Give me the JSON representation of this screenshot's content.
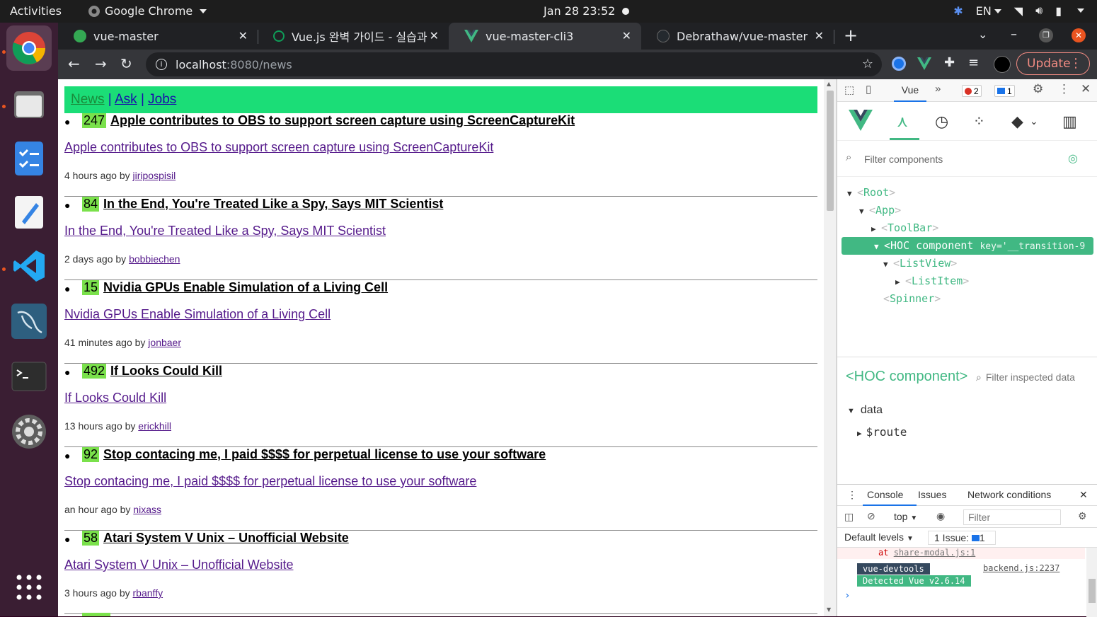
{
  "system": {
    "activities": "Activities",
    "app_name": "Google Chrome",
    "clock": "Jan 28  23:52",
    "lang": "EN"
  },
  "chrome": {
    "tabs": [
      {
        "title": "vue-master",
        "color": "#34a853"
      },
      {
        "title": "Vue.js 완벽 가이드 - 실습과",
        "color": "#0f9d58"
      },
      {
        "title": "vue-master-cli3",
        "color": "#41b883"
      },
      {
        "title": "Debrathaw/vue-master",
        "color": "#24292e"
      }
    ],
    "url_host": "localhost",
    "url_path": ":8080/news",
    "update_label": "Update"
  },
  "page": {
    "nav": [
      "News",
      "Ask",
      "Jobs"
    ],
    "nav_sep": "|",
    "items": [
      {
        "points": "247",
        "title": "Apple contributes to OBS to support screen capture using ScreenCaptureKit",
        "link": "Apple contributes to OBS to support screen capture using ScreenCaptureKit",
        "time": "4 hours ago by",
        "user": "jiripospisil"
      },
      {
        "points": "84",
        "title": "In the End, You're Treated Like a Spy, Says MIT Scientist",
        "link": "In the End, You're Treated Like a Spy, Says MIT Scientist",
        "time": "2 days ago by",
        "user": "bobbiechen"
      },
      {
        "points": "15",
        "title": "Nvidia GPUs Enable Simulation of a Living Cell",
        "link": "Nvidia GPUs Enable Simulation of a Living Cell",
        "time": "41 minutes ago by",
        "user": "jonbaer"
      },
      {
        "points": "492",
        "title": "If Looks Could Kill",
        "link": "If Looks Could Kill",
        "time": "13 hours ago by",
        "user": "erickhill"
      },
      {
        "points": "92",
        "title": "Stop contacing me, I paid $$$$ for perpetual license to use your software",
        "link": "Stop contacing me, I paid $$$$ for perpetual license to use your software",
        "time": "an hour ago by",
        "user": "nixass"
      },
      {
        "points": "58",
        "title": "Atari System V Unix – Unofficial Website",
        "link": "Atari System V Unix – Unofficial Website",
        "time": "3 hours ago by",
        "user": "rbanffy"
      }
    ]
  },
  "devtools": {
    "vue_tab": "Vue",
    "errors": "2",
    "messages": "1",
    "filter_placeholder": "Filter components",
    "tree": [
      {
        "name": "Root"
      },
      {
        "name": "App"
      },
      {
        "name": "ToolBar"
      },
      {
        "name": "HOC component",
        "attr": "key='__transition-9"
      },
      {
        "name": "ListView"
      },
      {
        "name": "ListItem"
      },
      {
        "name": "Spinner"
      }
    ],
    "inspector_title": "<HOC component>",
    "inspector_filter": "Filter inspected data",
    "data_label": "data",
    "route_label": "$route",
    "console_tabs": [
      "Console",
      "Issues",
      "Network conditions"
    ],
    "context": "top",
    "console_filter": "Filter",
    "levels": "Default levels",
    "issues": "1 Issue:",
    "issues_count": "1",
    "log_at": "at",
    "log_file": "share-modal.js:1",
    "log_tag": "vue-devtools",
    "log_msg": "Detected Vue v2.6.14",
    "log_src": "backend.js:2237"
  }
}
